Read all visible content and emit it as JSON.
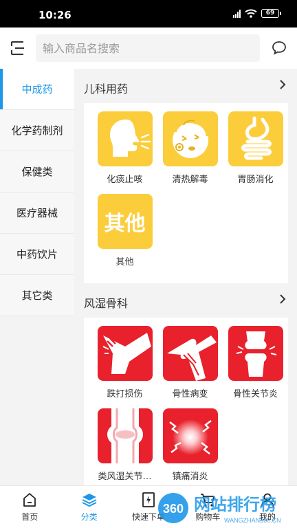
{
  "status_bar": {
    "time": "10:26",
    "battery": "69"
  },
  "search": {
    "placeholder": "输入商品名搜索"
  },
  "sidebar": {
    "items": [
      {
        "label": "中成药",
        "active": true
      },
      {
        "label": "化学药制剂",
        "active": false
      },
      {
        "label": "保健类",
        "active": false
      },
      {
        "label": "医疗器械",
        "active": false
      },
      {
        "label": "中药饮片",
        "active": false
      },
      {
        "label": "其它类",
        "active": false
      }
    ]
  },
  "sections": [
    {
      "title": "儿科用药",
      "items": [
        {
          "label": "化痰止咳",
          "icon": "cough-icon"
        },
        {
          "label": "清热解毒",
          "icon": "fever-icon"
        },
        {
          "label": "胃肠消化",
          "icon": "stomach-icon"
        },
        {
          "label": "其他",
          "icon": "other-icon",
          "icon_text": "其他"
        }
      ]
    },
    {
      "title": "风湿骨科",
      "items": [
        {
          "label": "跌打损伤",
          "icon": "knee-injury-icon"
        },
        {
          "label": "骨性病变",
          "icon": "bone-lesion-icon"
        },
        {
          "label": "骨性关节炎",
          "icon": "arthritis-icon"
        },
        {
          "label": "类风湿关节炎",
          "display": "类风湿关节…",
          "icon": "rheumatoid-icon"
        },
        {
          "label": "镇痛消炎",
          "icon": "pain-relief-icon"
        }
      ]
    }
  ],
  "bottom_nav": [
    {
      "label": "首页",
      "icon": "home-icon",
      "active": false
    },
    {
      "label": "分类",
      "icon": "category-icon",
      "active": true
    },
    {
      "label": "快速下单",
      "icon": "quick-order-icon",
      "active": false
    },
    {
      "label": "购物车",
      "icon": "cart-icon",
      "active": false
    },
    {
      "label": "我的",
      "icon": "user-icon",
      "active": false
    }
  ],
  "watermark": {
    "number": "360",
    "text": "网站排行榜",
    "sub": "WANGZHAN360.CN"
  },
  "colors": {
    "accent": "#1e97e8",
    "pediatric_tile": "#fccd3b",
    "ortho_tile": "#e8212c"
  }
}
